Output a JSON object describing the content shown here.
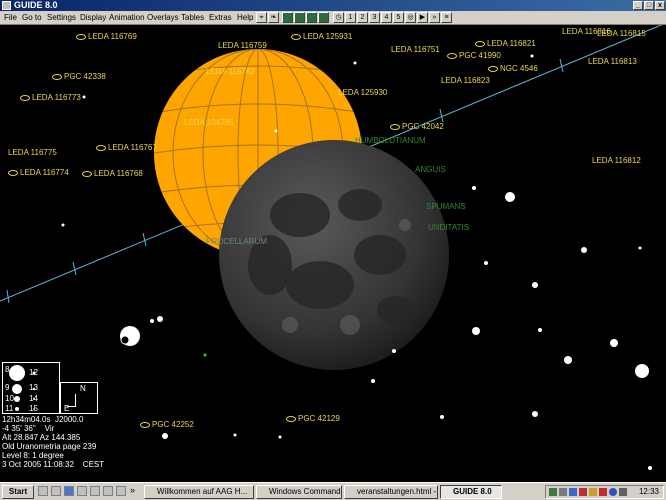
{
  "app": {
    "title": "GUIDE 8.0"
  },
  "menu": [
    "File",
    "Go to",
    "Settings",
    "Display",
    "Animation",
    "Overlays",
    "Tables",
    "Extras",
    "Help"
  ],
  "toolbar": {
    "zoom_buttons": [
      "1",
      "2",
      "3",
      "4",
      "5"
    ]
  },
  "sky": {
    "sun_color": "#ffa500",
    "moon_color": "#3a3a3a",
    "ecliptic_color": "#5fb4d4",
    "label_color": "#e8d84a",
    "galaxies": [
      "LEDA 116769",
      "LEDA 116759",
      "LEDA 125931",
      "LEDA 116751",
      "LEDA 116821",
      "LEDA 116816",
      "LEDA 116815",
      "PGC 41990",
      "NGC 4546",
      "LEDA 116813",
      "PGC 42338",
      "LEDA 116762",
      "LEDA 116773",
      "LEDA 116823",
      "LEDA 125930",
      "LEDA 104785",
      "PGC 42042",
      "LEDA 116775",
      "LEDA 116767",
      "LEDA 116812",
      "LEDA 116774",
      "LEDA 116768",
      "PGC 42252",
      "PGC 42129"
    ],
    "moon_features": [
      "HUMBOLDTIANUM",
      "ANGUIS",
      "SPUMANS",
      "UNDITATIS",
      "PROCELLARUM"
    ]
  },
  "legend": {
    "magnitudes": [
      "8",
      "12",
      "9",
      "13",
      "10",
      "14",
      "11",
      "15"
    ],
    "north": "N",
    "east": "E"
  },
  "status": {
    "ra": "12h34m04.0s",
    "epoch": "J2000.0",
    "dec": "-4 35' 36\"",
    "constellation": "Vir",
    "altaz": "Alt 28.847  Az 144.385",
    "atlas": "Old Uranometria page 239",
    "level": "Level 8: 1 degree",
    "datetime": "3 Oct 2005 11:08:32",
    "timezone": "CEST"
  },
  "taskbar": {
    "start": "Start",
    "tasks": [
      "Willkommen auf AAG H...",
      "Windows Commander 4...",
      "veranstaltungen.html - E...",
      "GUIDE 8.0"
    ],
    "clock": "12:33"
  }
}
